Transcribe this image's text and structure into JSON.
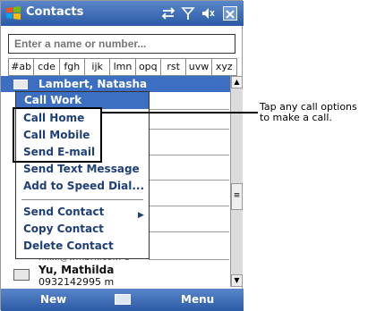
{
  "window": {
    "title": "Contacts",
    "close_label": "×"
  },
  "search": {
    "placeholder": "Enter a name or number..."
  },
  "tabs": [
    "#ab",
    "cde",
    "fgh",
    "ijk",
    "lmn",
    "opq",
    "rst",
    "uvw",
    "xyz"
  ],
  "selected_contact": {
    "name": "Lambert, Natasha"
  },
  "context_menu": {
    "items": [
      {
        "label": "Call Work"
      },
      {
        "label": "Call Home"
      },
      {
        "label": "Call Mobile"
      },
      {
        "label": "Send E-mail"
      },
      {
        "label": "Send Text Message"
      },
      {
        "label": "Add to Speed Dial..."
      },
      {
        "label": "Send Contact"
      },
      {
        "label": "Copy Contact"
      },
      {
        "label": "Delete Contact"
      }
    ]
  },
  "peek_email": "nikki@wmbrk.com e",
  "contact_row": {
    "name": "Yu, Mathilda",
    "phone": "0932142995 m"
  },
  "bottom_bar": {
    "left_label": "New",
    "right_label": "Menu"
  },
  "callout": {
    "line1": "Tap any call options",
    "line2": "to make a call."
  },
  "colors": {
    "titlebar": "#2b5aa6",
    "selection": "#3c6fc2",
    "menu_text": "#1e3f7a"
  }
}
